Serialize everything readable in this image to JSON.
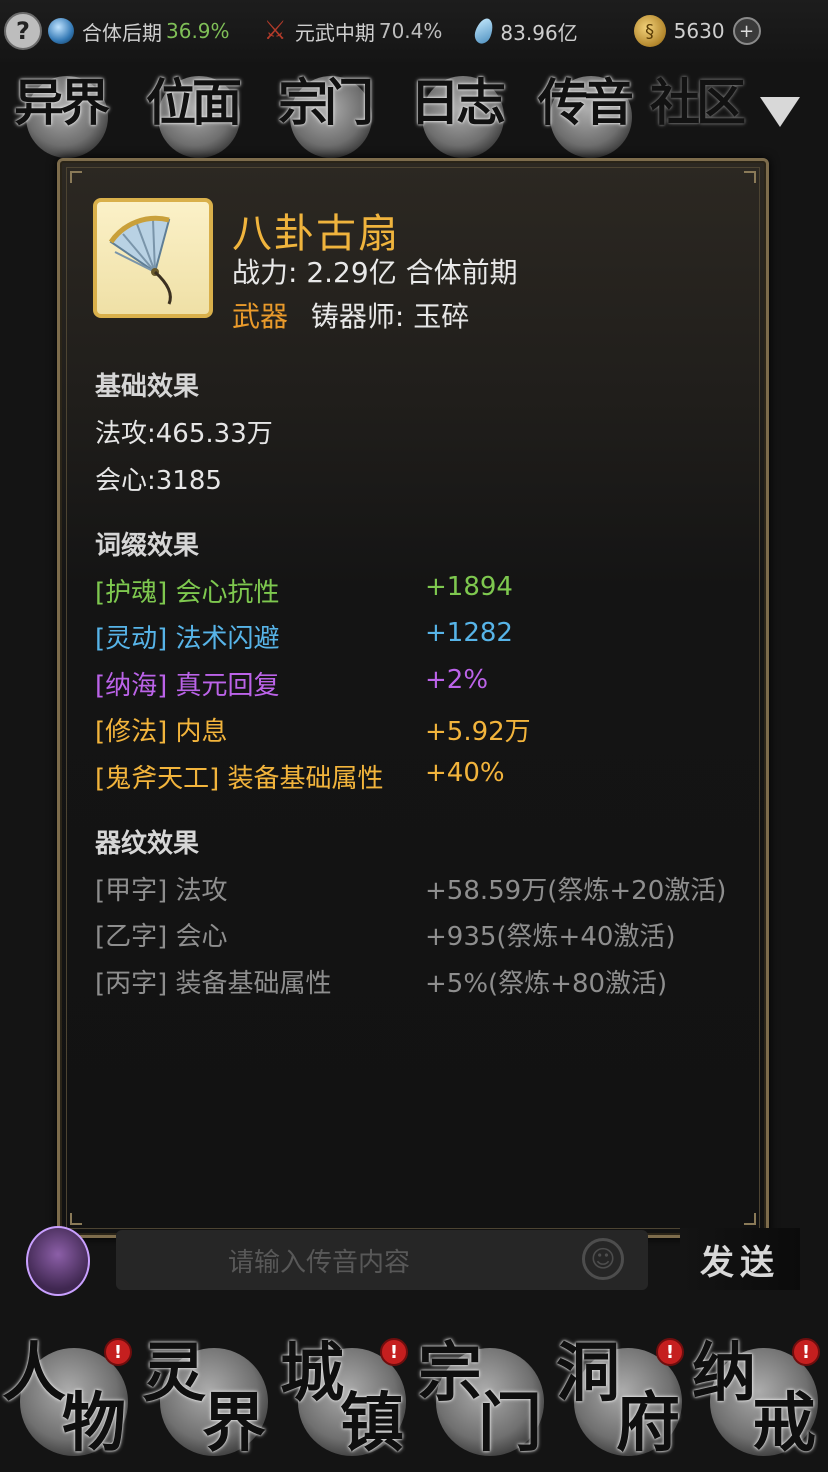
{
  "status_bar": {
    "help": "?",
    "realm": "合体后期",
    "realm_pct": "36.9%",
    "martial": "元武中期",
    "martial_pct": "70.4%",
    "spirit_stones": "83.96亿",
    "gold": "5630",
    "plus": "+"
  },
  "top_nav": {
    "tabs": [
      {
        "label": "异界"
      },
      {
        "label": "位面"
      },
      {
        "label": "宗门"
      },
      {
        "label": "日志"
      },
      {
        "label": "传音"
      },
      {
        "label": "社区"
      }
    ]
  },
  "item": {
    "name": "八卦古扇",
    "power_label": "战力:",
    "power_value": "2.29亿",
    "power_rank": "合体前期",
    "type": "武器",
    "maker_label": "铸器师:",
    "maker": "玉碎",
    "base_title": "基础效果",
    "base": [
      {
        "label": "法攻:",
        "value": "465.33万"
      },
      {
        "label": "会心:",
        "value": "3185"
      }
    ],
    "affix_title": "词缀效果",
    "affixes": [
      {
        "label": "[护魂] 会心抗性",
        "value": "+1894"
      },
      {
        "label": "[灵动] 法术闪避",
        "value": "+1282"
      },
      {
        "label": "[纳海] 真元回复",
        "value": "+2%"
      },
      {
        "label": "[修法] 内息",
        "value": "+5.92万"
      },
      {
        "label": "[鬼斧天工] 装备基础属性",
        "value": "+40%"
      }
    ],
    "rune_title": "器纹效果",
    "runes": [
      {
        "label": "[甲字] 法攻",
        "value": "+58.59万(祭炼+20激活)"
      },
      {
        "label": "[乙字] 会心",
        "value": "+935(祭炼+40激活)"
      },
      {
        "label": "[丙字] 装备基础属性",
        "value": "+5%(祭炼+80激活)"
      }
    ]
  },
  "chat": {
    "placeholder": "请输入传音内容",
    "send": "发送"
  },
  "bottom_nav": {
    "tabs": [
      {
        "label1": "人",
        "label2": "物"
      },
      {
        "label1": "灵",
        "label2": "界"
      },
      {
        "label1": "城",
        "label2": "镇"
      },
      {
        "label1": "宗",
        "label2": "门"
      },
      {
        "label1": "洞",
        "label2": "府"
      },
      {
        "label1": "纳",
        "label2": "戒"
      }
    ],
    "badge": "!"
  }
}
